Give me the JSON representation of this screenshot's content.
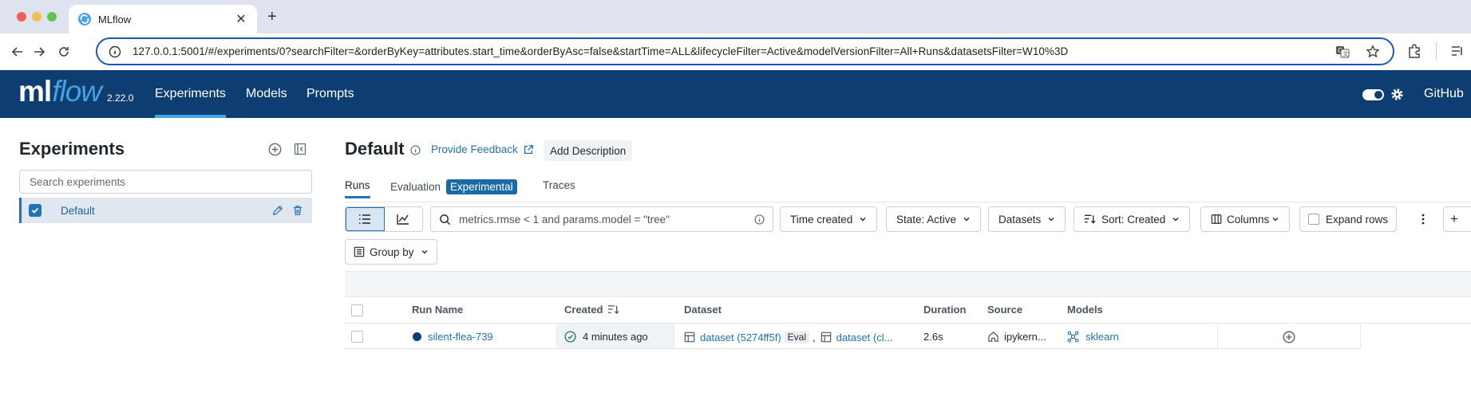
{
  "browser": {
    "tab_title": "MLflow",
    "url": "127.0.0.1:5001/#/experiments/0?searchFilter=&orderByKey=attributes.start_time&orderByAsc=false&startTime=ALL&lifecycleFilter=Active&modelVersionFilter=All+Runs&datasetsFilter=W10%3D"
  },
  "header": {
    "logo_ml": "ml",
    "logo_flow": "flow",
    "version": "2.22.0",
    "nav": [
      "Experiments",
      "Models",
      "Prompts"
    ],
    "github": "GitHub"
  },
  "sidebar": {
    "title": "Experiments",
    "search_placeholder": "Search experiments",
    "items": [
      {
        "label": "Default",
        "checked": true
      }
    ]
  },
  "main": {
    "title": "Default",
    "feedback": "Provide Feedback",
    "add_description": "Add Description",
    "tabs": {
      "runs": "Runs",
      "evaluation": "Evaluation",
      "experimental": "Experimental",
      "traces": "Traces"
    },
    "search_text": "metrics.rmse < 1 and params.model = \"tree\"",
    "filters": {
      "time": "Time created",
      "state": "State: Active",
      "datasets": "Datasets",
      "sort": "Sort: Created",
      "columns": "Columns",
      "expand": "Expand rows",
      "group_by": "Group by"
    },
    "table": {
      "headers": {
        "run_name": "Run Name",
        "created": "Created",
        "dataset": "Dataset",
        "duration": "Duration",
        "source": "Source",
        "models": "Models"
      },
      "rows": [
        {
          "run_name": "silent-flea-739",
          "created": "4 minutes ago",
          "dataset_1": "dataset (5274ff5f)",
          "dataset_tag": "Eval",
          "separator": ",",
          "dataset_2": "dataset (cl...",
          "duration": "2.6s",
          "source": "ipykern...",
          "model": "sklearn"
        }
      ]
    }
  },
  "colors": {
    "header_bg": "#0e3e71",
    "accent": "#43a3e3",
    "link": "#2272b4",
    "success": "#277c43"
  }
}
